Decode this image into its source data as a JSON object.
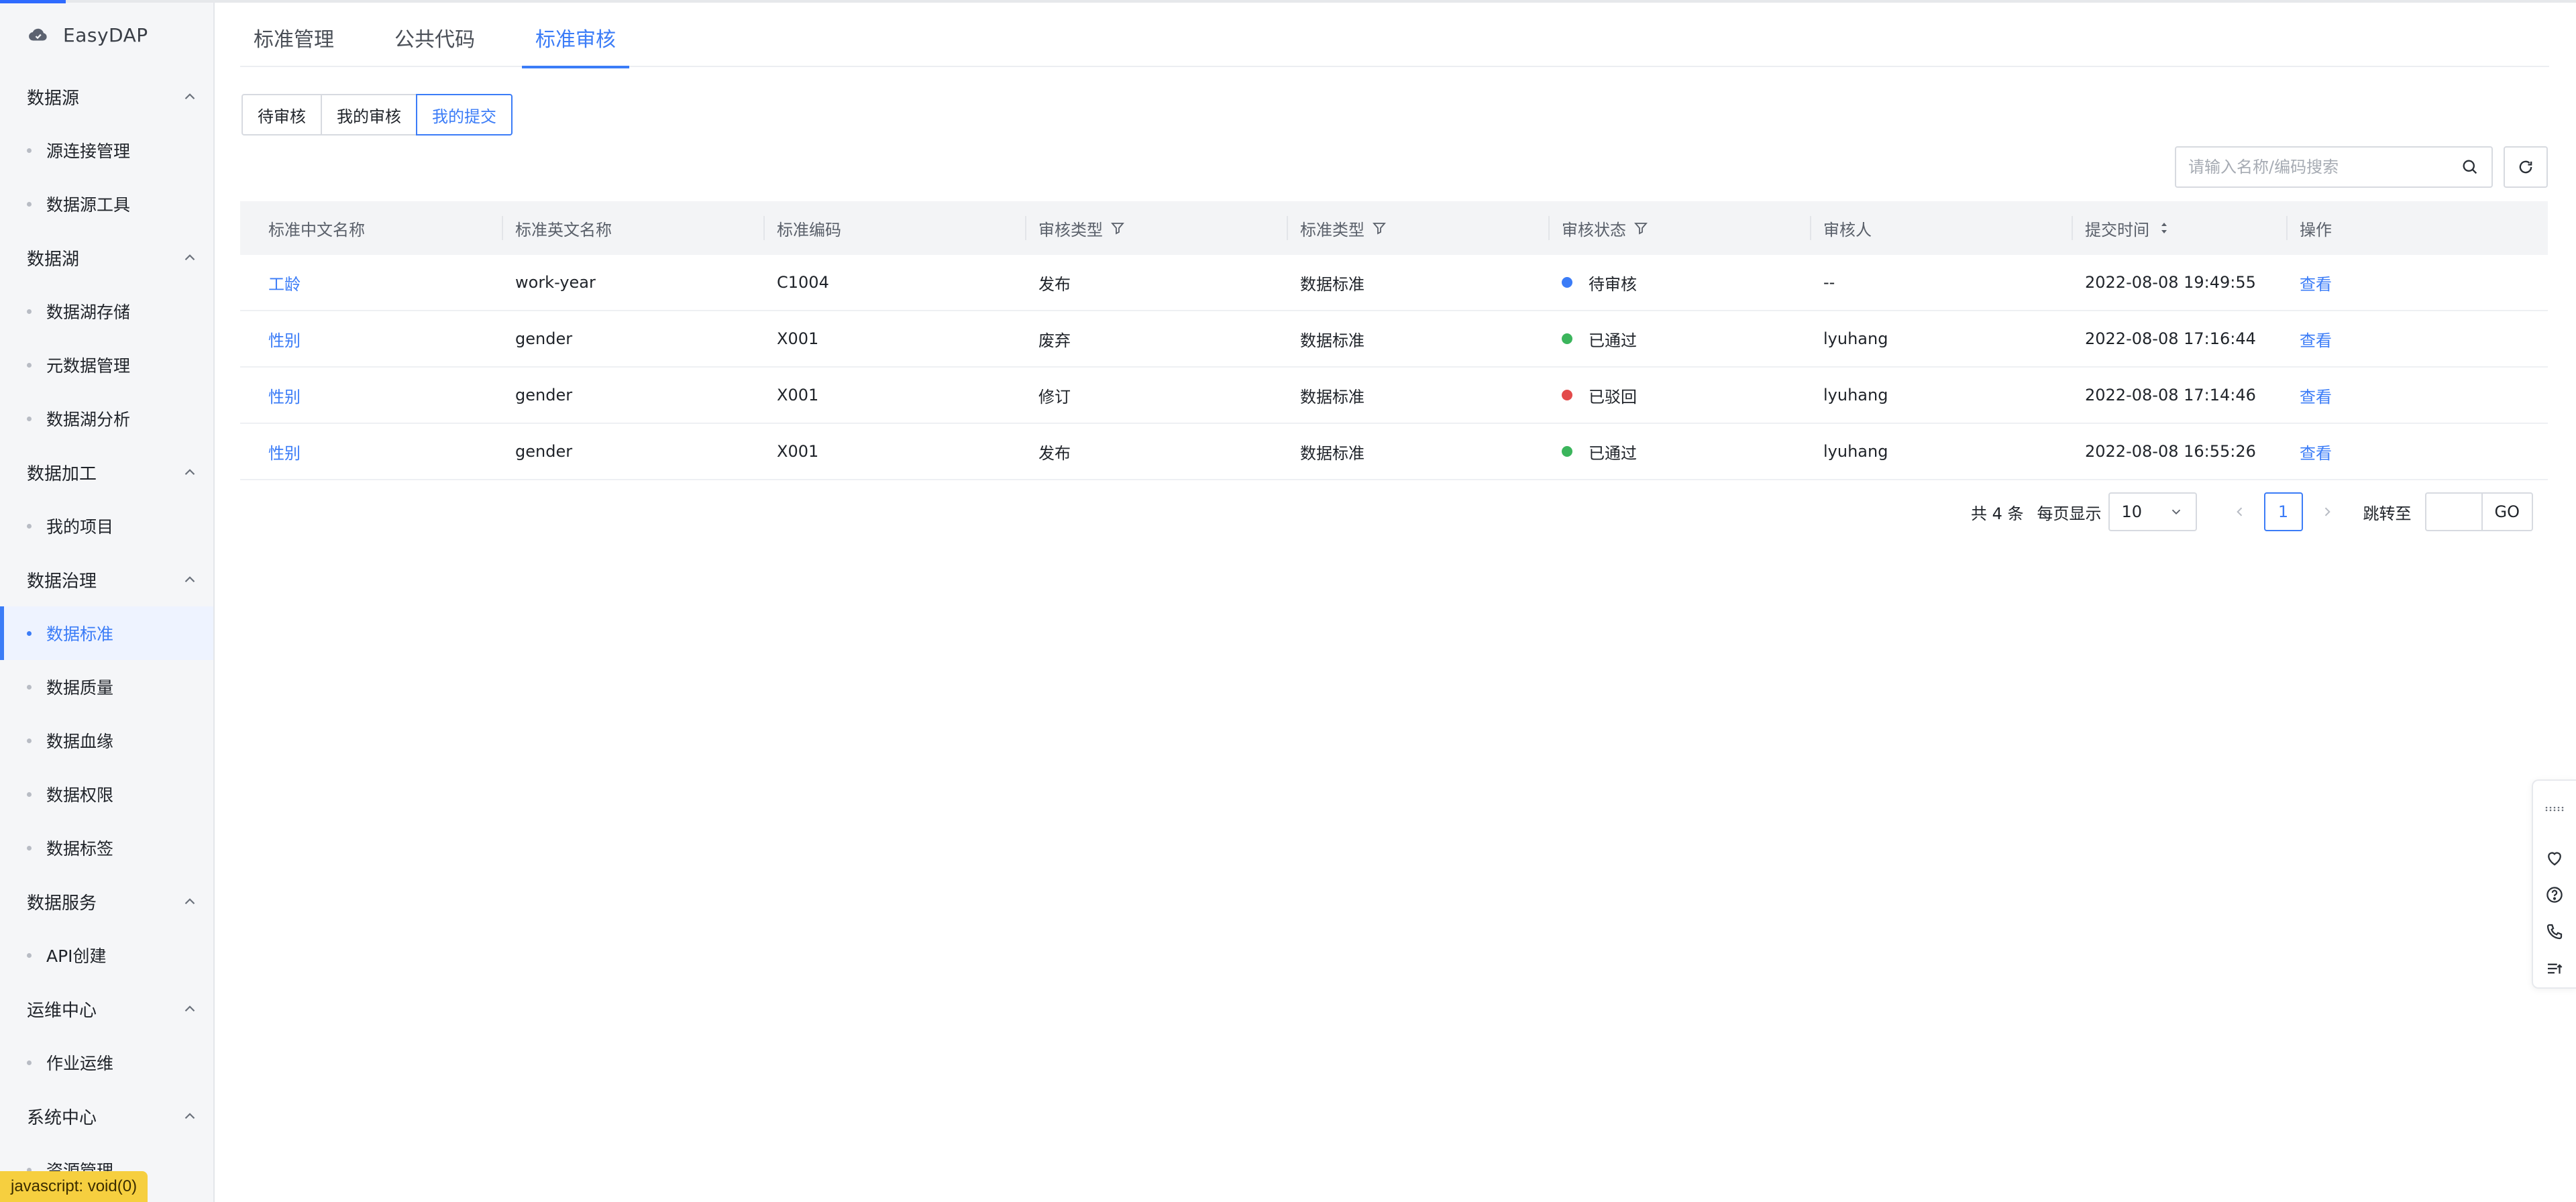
{
  "app": {
    "name": "EasyDAP"
  },
  "sidebar": {
    "groups": [
      {
        "label": "数据源",
        "items": [
          {
            "label": "源连接管理"
          },
          {
            "label": "数据源工具"
          }
        ]
      },
      {
        "label": "数据湖",
        "items": [
          {
            "label": "数据湖存储"
          },
          {
            "label": "元数据管理"
          },
          {
            "label": "数据湖分析"
          }
        ]
      },
      {
        "label": "数据加工",
        "items": [
          {
            "label": "我的项目"
          }
        ]
      },
      {
        "label": "数据治理",
        "items": [
          {
            "label": "数据标准",
            "active": true
          },
          {
            "label": "数据质量"
          },
          {
            "label": "数据血缘"
          },
          {
            "label": "数据权限"
          },
          {
            "label": "数据标签"
          }
        ]
      },
      {
        "label": "数据服务",
        "items": [
          {
            "label": "API创建"
          }
        ]
      },
      {
        "label": "运维中心",
        "items": [
          {
            "label": "作业运维"
          }
        ]
      },
      {
        "label": "系统中心",
        "items": [
          {
            "label": "资源管理"
          }
        ]
      }
    ]
  },
  "status_tip": "javascript: void(0)",
  "tabs": [
    {
      "label": "标准管理"
    },
    {
      "label": "公共代码"
    },
    {
      "label": "标准审核",
      "active": true
    }
  ],
  "segments": [
    {
      "label": "待审核"
    },
    {
      "label": "我的审核"
    },
    {
      "label": "我的提交",
      "active": true
    }
  ],
  "search": {
    "placeholder": "请输入名称/编码搜索",
    "value": ""
  },
  "table": {
    "columns": [
      {
        "label": "标准中文名称"
      },
      {
        "label": "标准英文名称"
      },
      {
        "label": "标准编码"
      },
      {
        "label": "审核类型",
        "icon": "filter-icon"
      },
      {
        "label": "标准类型",
        "icon": "filter-icon"
      },
      {
        "label": "审核状态",
        "icon": "filter-icon"
      },
      {
        "label": "审核人"
      },
      {
        "label": "提交时间",
        "icon": "sort-icon"
      },
      {
        "label": "操作"
      }
    ],
    "rows": [
      {
        "cn_name": "工龄",
        "en_name": "work-year",
        "code": "C1004",
        "review_type": "发布",
        "std_type": "数据标准",
        "status": "待审核",
        "status_color": "#3b7cf7",
        "reviewer": "--",
        "time": "2022-08-08 19:49:55",
        "action": "查看"
      },
      {
        "cn_name": "性别",
        "en_name": "gender",
        "code": "X001",
        "review_type": "废弃",
        "std_type": "数据标准",
        "status": "已通过",
        "status_color": "#3bb55c",
        "reviewer": "lyuhang",
        "time": "2022-08-08 17:16:44",
        "action": "查看"
      },
      {
        "cn_name": "性别",
        "en_name": "gender",
        "code": "X001",
        "review_type": "修订",
        "std_type": "数据标准",
        "status": "已驳回",
        "status_color": "#e34a4a",
        "reviewer": "lyuhang",
        "time": "2022-08-08 17:14:46",
        "action": "查看"
      },
      {
        "cn_name": "性别",
        "en_name": "gender",
        "code": "X001",
        "review_type": "发布",
        "std_type": "数据标准",
        "status": "已通过",
        "status_color": "#3bb55c",
        "reviewer": "lyuhang",
        "time": "2022-08-08 16:55:26",
        "action": "查看"
      }
    ]
  },
  "pagination": {
    "total": "共 4 条",
    "per_page_label": "每页显示",
    "page_size": "10",
    "current_page": "1",
    "jump_label": "跳转至",
    "jump_value": "",
    "go_label": "GO"
  },
  "colors": {
    "accent": "#3b7cf7",
    "status_tip_bg": "#f6cf3f"
  },
  "float_toolbar": {
    "icons": [
      "grip-icon",
      "heart-icon",
      "help-icon",
      "phone-icon",
      "list-icon"
    ]
  }
}
